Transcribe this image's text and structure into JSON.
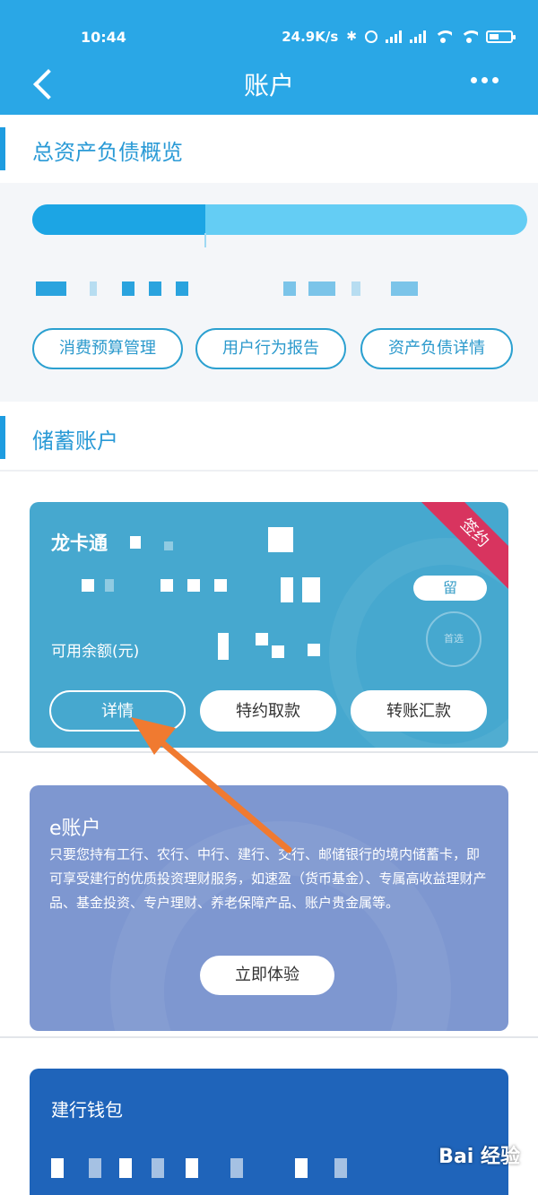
{
  "status_bar": {
    "time": "10:44",
    "net_speed": "24.9K/s"
  },
  "nav": {
    "title": "账户"
  },
  "overview": {
    "section_title": "总资产负债概览",
    "asset_ratio": 0.35,
    "buttons": [
      "消费预算管理",
      "用户行为报告",
      "资产负债详情"
    ]
  },
  "savings": {
    "section_title": "储蓄账户",
    "long_card": {
      "name": "龙卡通",
      "ribbon": "签约",
      "tag": "留",
      "stamp": "首选",
      "balance_label": "可用余额(元)",
      "buttons": [
        "详情",
        "特约取款",
        "转账汇款"
      ]
    },
    "e_account": {
      "title": "e账户",
      "description": "只要您持有工行、农行、中行、建行、交行、邮储银行的境内储蓄卡，即可享受建行的优质投资理财服务，如速盈（货币基金）、专属高收益理财产品、基金投资、专户理财、养老保障产品、账户贵金属等。",
      "button": "立即体验"
    },
    "third_card": {
      "title": "建行钱包"
    }
  },
  "watermark": "Bai 经验",
  "colors": {
    "header": "#2aa7e6",
    "accent": "#1e9ce0",
    "long_card": "#46a8cf",
    "e_card": "#7e97d0",
    "third_card": "#1f64ba",
    "ribbon": "#d8345f",
    "arrow": "#f07a30"
  }
}
